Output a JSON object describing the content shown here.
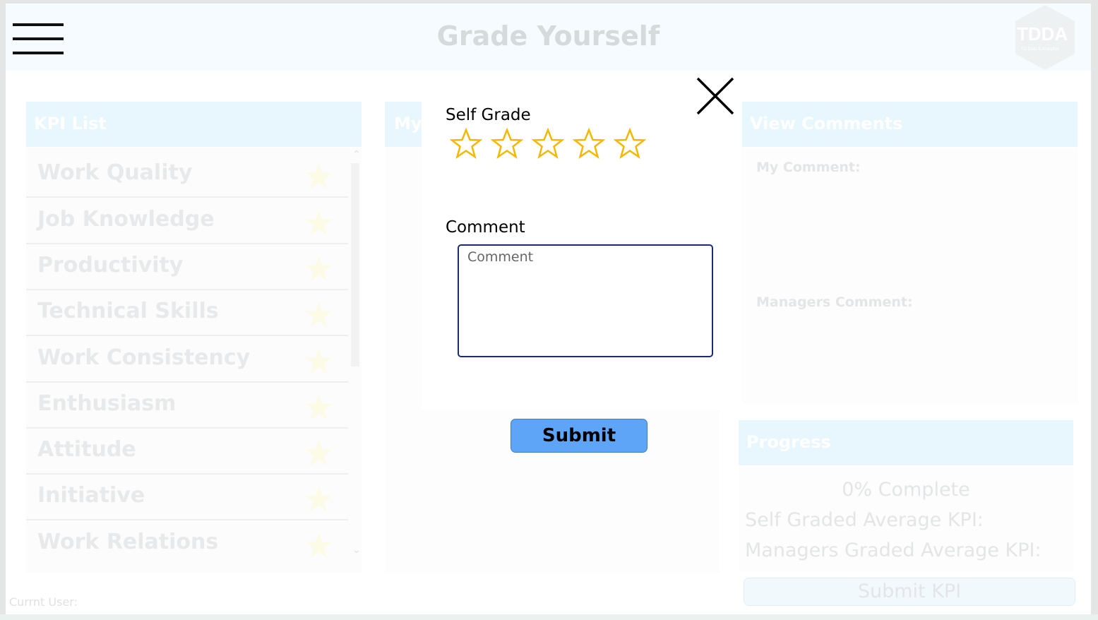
{
  "header": {
    "title": "Grade Yourself",
    "logo_text": "TDDA",
    "logo_subtext": "TD Data & Analytics"
  },
  "kpi_panel": {
    "title": "KPI List",
    "items": [
      {
        "label": "Work Quality"
      },
      {
        "label": "Job Knowledge"
      },
      {
        "label": "Productivity"
      },
      {
        "label": "Technical Skills"
      },
      {
        "label": "Work Consistency"
      },
      {
        "label": "Enthusiasm"
      },
      {
        "label": "Attitude"
      },
      {
        "label": "Initiative"
      },
      {
        "label": "Work Relations"
      }
    ]
  },
  "middle_panel": {
    "title": "My S"
  },
  "comments_panel": {
    "title": "View Comments",
    "my_comment_label": "My Comment:",
    "managers_comment_label": "Managers Comment:"
  },
  "progress_panel": {
    "title": "Progress",
    "complete_text": "0% Complete",
    "self_avg_label": "Self Graded Average KPI:",
    "manager_avg_label": "Managers Graded Average KPI:",
    "submit_kpi_label": "Submit KPI"
  },
  "footer": {
    "current_user_label": "Currnt User:"
  },
  "dialog": {
    "self_grade_label": "Self Grade",
    "rating_value": 0,
    "rating_max": 5,
    "comment_label": "Comment",
    "comment_placeholder": "Comment",
    "comment_value": "",
    "submit_label": "Submit"
  },
  "colors": {
    "star_outline": "#f5b800",
    "submit_bg": "#5ea5f8",
    "panel_header": "#e8f6fd"
  },
  "icons": {
    "menu": "hamburger-icon",
    "close": "close-icon",
    "rating": "star-icon"
  }
}
